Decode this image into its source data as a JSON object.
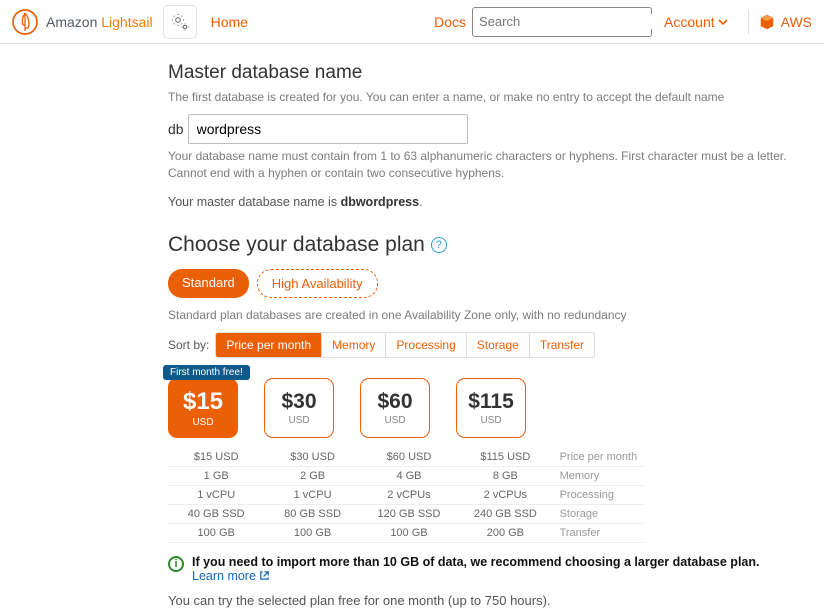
{
  "header": {
    "logo_brand": "Amazon",
    "logo_product": "Lightsail",
    "home_label": "Home",
    "docs_label": "Docs",
    "search_placeholder": "Search",
    "account_label": "Account",
    "aws_label": "AWS"
  },
  "master_db": {
    "title": "Master database name",
    "subtitle": "The first database is created for you. You can enter a name, or make no entry to accept the default name",
    "prefix": "db",
    "value": "wordpress",
    "hint": "Your database name must contain from 1 to 63 alphanumeric characters or hyphens. First character must be a letter. Cannot end with a hyphen or contain two consecutive hyphens.",
    "confirm_prefix": "Your master database name is ",
    "confirm_value": "dbwordpress"
  },
  "plan": {
    "title": "Choose your database plan",
    "tabs": {
      "standard": "Standard",
      "ha": "High Availability"
    },
    "description": "Standard plan databases are created in one Availability Zone only, with no redundancy",
    "sort_label": "Sort by:",
    "sort_options": [
      "Price per month",
      "Memory",
      "Processing",
      "Storage",
      "Transfer"
    ],
    "badge": "First month free!",
    "cards": [
      {
        "price": "$15",
        "usd": "USD"
      },
      {
        "price": "$30",
        "usd": "USD"
      },
      {
        "price": "$60",
        "usd": "USD"
      },
      {
        "price": "$115",
        "usd": "USD"
      }
    ],
    "spec_rows": [
      {
        "label": "Price per month",
        "values": [
          "$15 USD",
          "$30 USD",
          "$60 USD",
          "$115 USD"
        ]
      },
      {
        "label": "Memory",
        "values": [
          "1 GB",
          "2 GB",
          "4 GB",
          "8 GB"
        ]
      },
      {
        "label": "Processing",
        "values": [
          "1 vCPU",
          "1 vCPU",
          "2 vCPUs",
          "2 vCPUs"
        ]
      },
      {
        "label": "Storage",
        "values": [
          "40 GB SSD",
          "80 GB SSD",
          "120 GB SSD",
          "240 GB SSD"
        ]
      },
      {
        "label": "Transfer",
        "values": [
          "100 GB",
          "100 GB",
          "100 GB",
          "200 GB"
        ]
      }
    ],
    "info_text": "If you need to import more than 10 GB of data, we recommend choosing a larger database plan.",
    "learn_more": "Learn more",
    "trial_text": "You can try the selected plan free for one month (up to 750 hours)."
  }
}
